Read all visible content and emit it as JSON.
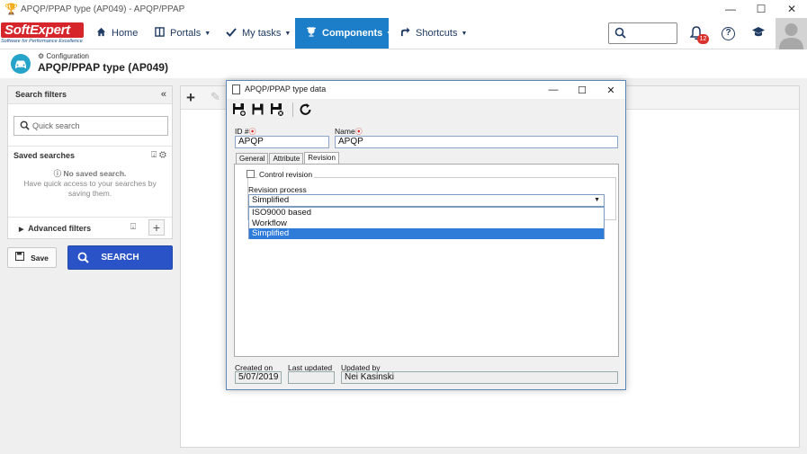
{
  "window": {
    "title": "APQP/PPAP type (AP049) - APQP/PPAP"
  },
  "logo": {
    "brand": "SoftExpert",
    "tagline": "Software for Performance Excellence"
  },
  "nav": {
    "items": [
      {
        "label": "Home",
        "icon": "home-icon"
      },
      {
        "label": "Portals",
        "icon": "portals-icon"
      },
      {
        "label": "My tasks",
        "icon": "check-icon"
      },
      {
        "label": "Components",
        "icon": "trophy-icon"
      },
      {
        "label": "Shortcuts",
        "icon": "arrow-icon"
      }
    ],
    "active": "Components",
    "notification_count": "12",
    "accent_color": "#1c7ec8"
  },
  "page": {
    "breadcrumb": "Configuration",
    "title": "APQP/PPAP type (AP049)"
  },
  "filters": {
    "header": "Search filters",
    "quick_search_placeholder": "Quick search",
    "saved_searches": "Saved searches",
    "no_saved_title": "No saved search.",
    "no_saved_line1": "Have quick access to your searches by",
    "no_saved_line2": "saving them.",
    "advanced_filters": "Advanced filters",
    "save_label": "Save",
    "search_label": "SEARCH"
  },
  "dialog": {
    "title": "APQP/PPAP type data",
    "id_label": "ID #",
    "id_value": "APQP",
    "name_label": "Name",
    "name_value": "APQP",
    "tabs": [
      "General",
      "Attribute",
      "Revision"
    ],
    "active_tab": "Revision",
    "control_revision_label": "Control revision",
    "revision_process_label": "Revision process",
    "revision_process_value": "Simplified",
    "revision_process_options": [
      "ISO9000 based",
      "Workflow",
      "Simplified"
    ],
    "created_on_label": "Created on",
    "created_on_value": "5/07/2019",
    "last_updated_label": "Last updated",
    "last_updated_value": "",
    "updated_by_label": "Updated by",
    "updated_by_value": "Nei Kasinski"
  }
}
